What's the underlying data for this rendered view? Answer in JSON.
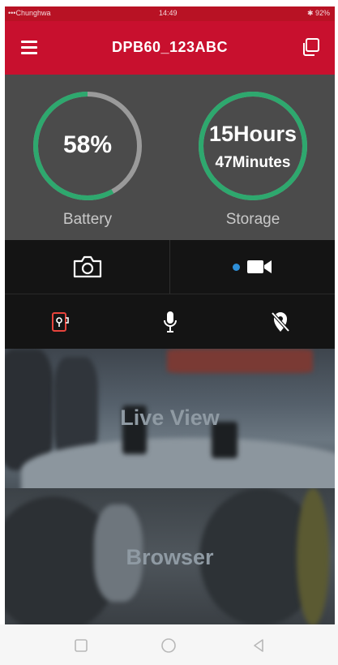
{
  "status_bar": {
    "carrier": "•••Chunghwa",
    "time": "14:49",
    "battery": "✱ 92%"
  },
  "header": {
    "title": "DPB60_123ABC"
  },
  "gauges": {
    "battery": {
      "value": "58%",
      "label": "Battery",
      "fraction": 0.58
    },
    "storage": {
      "hours": "15Hours",
      "minutes": "47Minutes",
      "label": "Storage",
      "fraction": 1.0
    }
  },
  "controls": {
    "video_mode_active": true
  },
  "tiles": {
    "live_view": "Live View",
    "browser": "Browser"
  },
  "colors": {
    "brand_red": "#c8102e",
    "gauge_green": "#2ea86e",
    "gauge_track": "#9a9a9a",
    "active_dot": "#2e8fd8"
  },
  "icons": [
    "menu-icon",
    "windows-icon",
    "camera-icon",
    "video-camera-icon",
    "badge-icon",
    "microphone-icon",
    "location-off-icon",
    "square-icon",
    "circle-icon",
    "back-triangle-icon"
  ]
}
